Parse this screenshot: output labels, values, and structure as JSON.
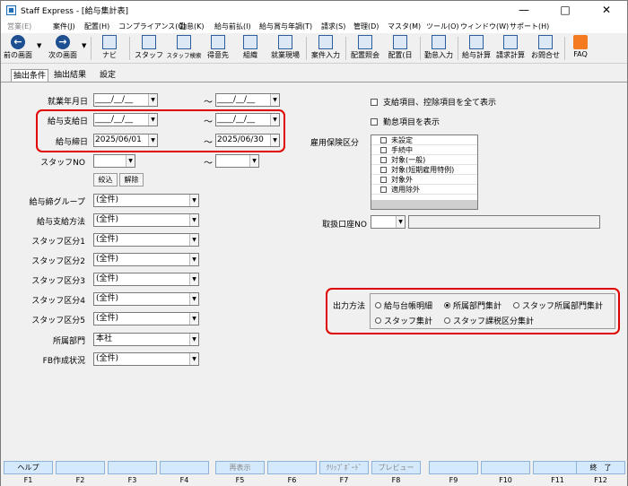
{
  "window": {
    "title": "Staff Express - [給与集計表]"
  },
  "menu": [
    {
      "label": "営業(E)",
      "dim": true
    },
    {
      "label": "案件(J)"
    },
    {
      "label": "配置(H)"
    },
    {
      "label": "コンプライアンス(C)"
    },
    {
      "label": "勤怠(K)"
    },
    {
      "label": "給与前払(I)"
    },
    {
      "label": "給与賞与年調(T)"
    },
    {
      "label": "請求(S)"
    },
    {
      "label": "管理(D)"
    },
    {
      "label": "マスタ(M)"
    },
    {
      "label": "ツール(O)"
    },
    {
      "label": "ウィンドウ(W)"
    },
    {
      "label": "サポート(H)"
    }
  ],
  "toolbar": [
    {
      "label": "前の画面",
      "icon": "back-arrow-icon"
    },
    {
      "label": "次の画面",
      "icon": "forward-arrow-icon"
    },
    {
      "label": "ナビ",
      "icon": "navi-icon"
    },
    {
      "label": "スタッフ",
      "icon": "staff-icon"
    },
    {
      "label": "スタッフ検索",
      "icon": "staff-search-icon"
    },
    {
      "label": "得意先",
      "icon": "client-icon"
    },
    {
      "label": "組織",
      "icon": "organization-icon"
    },
    {
      "label": "就業現場",
      "icon": "workplace-icon"
    },
    {
      "label": "案件入力",
      "icon": "case-input-icon"
    },
    {
      "label": "配置照会",
      "icon": "assignment-inquiry-icon"
    },
    {
      "label": "配置(日",
      "icon": "daily-assignment-icon"
    },
    {
      "label": "勤怠入力",
      "icon": "attendance-input-icon"
    },
    {
      "label": "給与計算",
      "icon": "payroll-calc-icon"
    },
    {
      "label": "請求計算",
      "icon": "billing-calc-icon"
    },
    {
      "label": "お問合せ",
      "icon": "inquiry-icon"
    },
    {
      "label": "FAQ",
      "icon": "faq-icon"
    }
  ],
  "tabs": [
    {
      "label": "抽出条件",
      "active": true
    },
    {
      "label": "抽出結果"
    },
    {
      "label": "設定"
    }
  ],
  "form": {
    "work_ym": {
      "label": "就業年月日",
      "from": "____/__/__",
      "to": "____/__/__"
    },
    "pay_date": {
      "label": "給与支給日",
      "from": "____/__/__",
      "to": "____/__/__"
    },
    "close_date": {
      "label": "給与締日",
      "from": "2025/06/01",
      "to": "2025/06/30"
    },
    "tilde": "～",
    "staff_no": {
      "label": "スタッフNO"
    },
    "filter_button": "絞込",
    "clear_button": "解除",
    "selects": [
      {
        "label": "給与締グループ",
        "value": "(全件)"
      },
      {
        "label": "給与支給方法",
        "value": "(全件)"
      },
      {
        "label": "スタッフ区分1",
        "value": "(全件)"
      },
      {
        "label": "スタッフ区分2",
        "value": "(全件)"
      },
      {
        "label": "スタッフ区分3",
        "value": "(全件)"
      },
      {
        "label": "スタッフ区分4",
        "value": "(全件)"
      },
      {
        "label": "スタッフ区分5",
        "value": "(全件)"
      },
      {
        "label": "所属部門",
        "value": "本社"
      },
      {
        "label": "FB作成状況",
        "value": "(全件)"
      }
    ],
    "show_all_items": "支給項目、控除項目を全て表示",
    "show_attendance_items": "勤怠項目を表示",
    "hoken": {
      "label": "雇用保険区分",
      "items": [
        "未設定",
        "手続中",
        "対象(一般)",
        "対象(短期雇用特例)",
        "対象外",
        "適用除外"
      ]
    },
    "account_no": {
      "label": "取扱口座NO"
    },
    "output": {
      "label": "出力方法",
      "options": [
        {
          "label": "給与台帳明細",
          "selected": false
        },
        {
          "label": "所属部門集計",
          "selected": true
        },
        {
          "label": "スタッフ所属部門集計",
          "selected": false
        },
        {
          "label": "スタッフ集計",
          "selected": false
        },
        {
          "label": "スタッフ課税区分集計",
          "selected": false
        }
      ]
    }
  },
  "fkeys": [
    {
      "label": "ヘルプ",
      "num": "F1"
    },
    {
      "label": "",
      "num": "F2"
    },
    {
      "label": "",
      "num": "F3"
    },
    {
      "label": "",
      "num": "F4"
    },
    {
      "label": "再表示",
      "num": "F5",
      "dim": true
    },
    {
      "label": "",
      "num": "F6"
    },
    {
      "label": "ｸﾘｯﾌﾟﾎﾞｰﾄﾞ",
      "num": "F7",
      "dim": true
    },
    {
      "label": "プレビュー",
      "num": "F8",
      "dim": true
    },
    {
      "label": "",
      "num": "F9"
    },
    {
      "label": "",
      "num": "F10"
    },
    {
      "label": "",
      "num": "F11"
    },
    {
      "label": "終　了",
      "num": "F12"
    }
  ],
  "highlight_color": "#e00000"
}
